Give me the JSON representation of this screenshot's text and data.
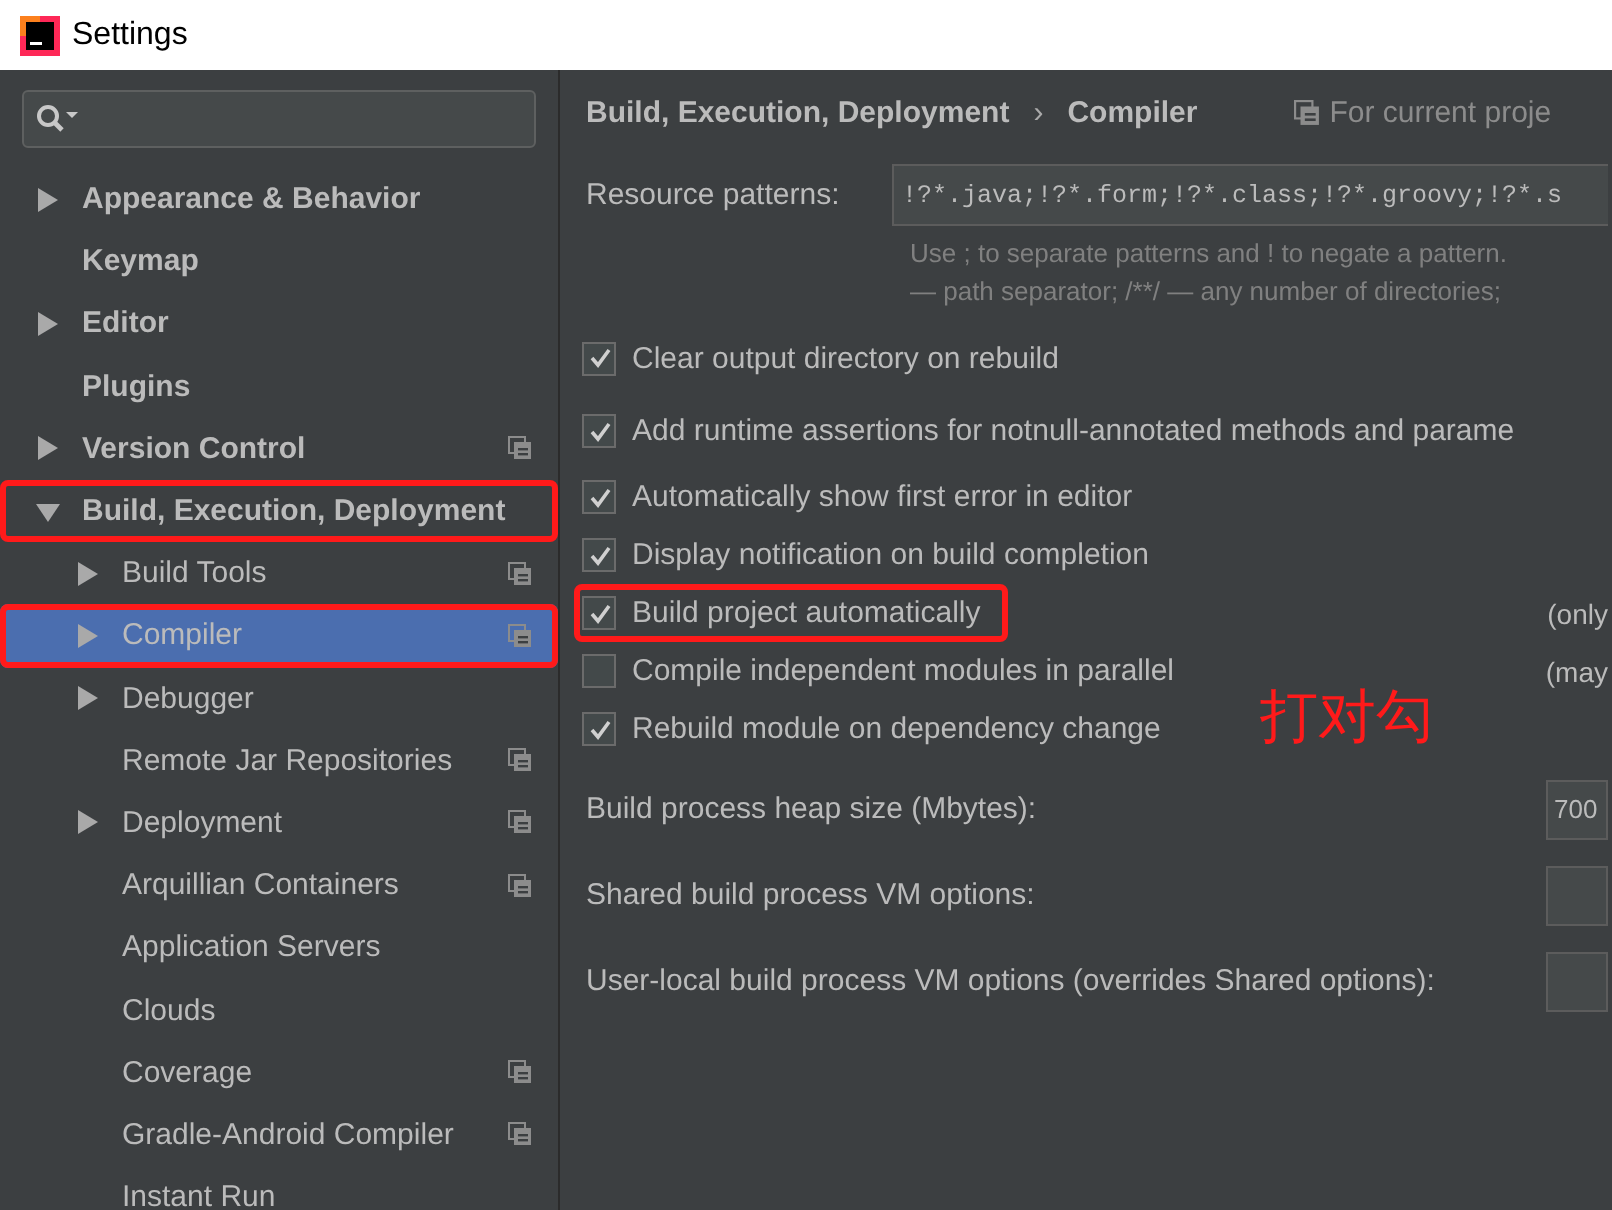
{
  "window": {
    "title": "Settings"
  },
  "sidebar": {
    "items": [
      {
        "label": "Appearance & Behavior",
        "expanded": false,
        "project_icon": false,
        "selected": false,
        "highlighted": false
      },
      {
        "label": "Keymap",
        "project_icon": false,
        "selected": false,
        "highlighted": false
      },
      {
        "label": "Editor",
        "expanded": false,
        "project_icon": false,
        "selected": false,
        "highlighted": false
      },
      {
        "label": "Plugins",
        "project_icon": false,
        "selected": false,
        "highlighted": false
      },
      {
        "label": "Version Control",
        "expanded": false,
        "project_icon": true,
        "selected": false,
        "highlighted": false
      },
      {
        "label": "Build, Execution, Deployment",
        "expanded": true,
        "project_icon": false,
        "selected": false,
        "highlighted": true,
        "children": [
          {
            "label": "Build Tools",
            "expanded": false,
            "project_icon": true,
            "selected": false,
            "highlighted": false
          },
          {
            "label": "Compiler",
            "expanded": false,
            "project_icon": true,
            "selected": true,
            "highlighted": true
          },
          {
            "label": "Debugger",
            "expanded": false,
            "project_icon": false,
            "selected": false,
            "highlighted": false
          },
          {
            "label": "Remote Jar Repositories",
            "project_icon": true,
            "selected": false,
            "highlighted": false
          },
          {
            "label": "Deployment",
            "expanded": false,
            "project_icon": true,
            "selected": false,
            "highlighted": false
          },
          {
            "label": "Arquillian Containers",
            "project_icon": true,
            "selected": false,
            "highlighted": false
          },
          {
            "label": "Application Servers",
            "project_icon": false,
            "selected": false,
            "highlighted": false
          },
          {
            "label": "Clouds",
            "project_icon": false,
            "selected": false,
            "highlighted": false
          },
          {
            "label": "Coverage",
            "project_icon": true,
            "selected": false,
            "highlighted": false
          },
          {
            "label": "Gradle-Android Compiler",
            "project_icon": true,
            "selected": false,
            "highlighted": false
          },
          {
            "label": "Instant Run",
            "project_icon": false,
            "selected": false,
            "highlighted": false
          }
        ]
      }
    ]
  },
  "breadcrumb": {
    "parent": "Build, Execution, Deployment",
    "separator": "›",
    "current": "Compiler",
    "scope": "For current proje"
  },
  "resource_patterns": {
    "label": "Resource patterns:",
    "value": "!?*.java;!?*.form;!?*.class;!?*.groovy;!?*.s",
    "hint": [
      "Use ; to separate patterns and ! to negate a pattern.",
      "— path separator; /**/ — any number of directories;"
    ]
  },
  "options": [
    {
      "label": "Clear output directory on rebuild",
      "checked": true,
      "highlighted": false
    },
    {
      "label": "Add runtime assertions for notnull-annotated methods and parame",
      "checked": true,
      "highlighted": false
    },
    {
      "label": "Automatically show first error in editor",
      "checked": true,
      "highlighted": false
    },
    {
      "label": "Display notification on build completion",
      "checked": true,
      "highlighted": false
    },
    {
      "label": "Build project automatically",
      "checked": true,
      "highlighted": true,
      "note": "(only"
    },
    {
      "label": "Compile independent modules in parallel",
      "checked": false,
      "highlighted": false,
      "note": "(may"
    },
    {
      "label": "Rebuild module on dependency change",
      "checked": true,
      "highlighted": false
    }
  ],
  "fields": [
    {
      "label": "Build process heap size (Mbytes):",
      "value": "700"
    },
    {
      "label": "Shared build process VM options:"
    },
    {
      "label": "User-local build process VM options (overrides Shared options):"
    }
  ],
  "annotation": "打对勾"
}
